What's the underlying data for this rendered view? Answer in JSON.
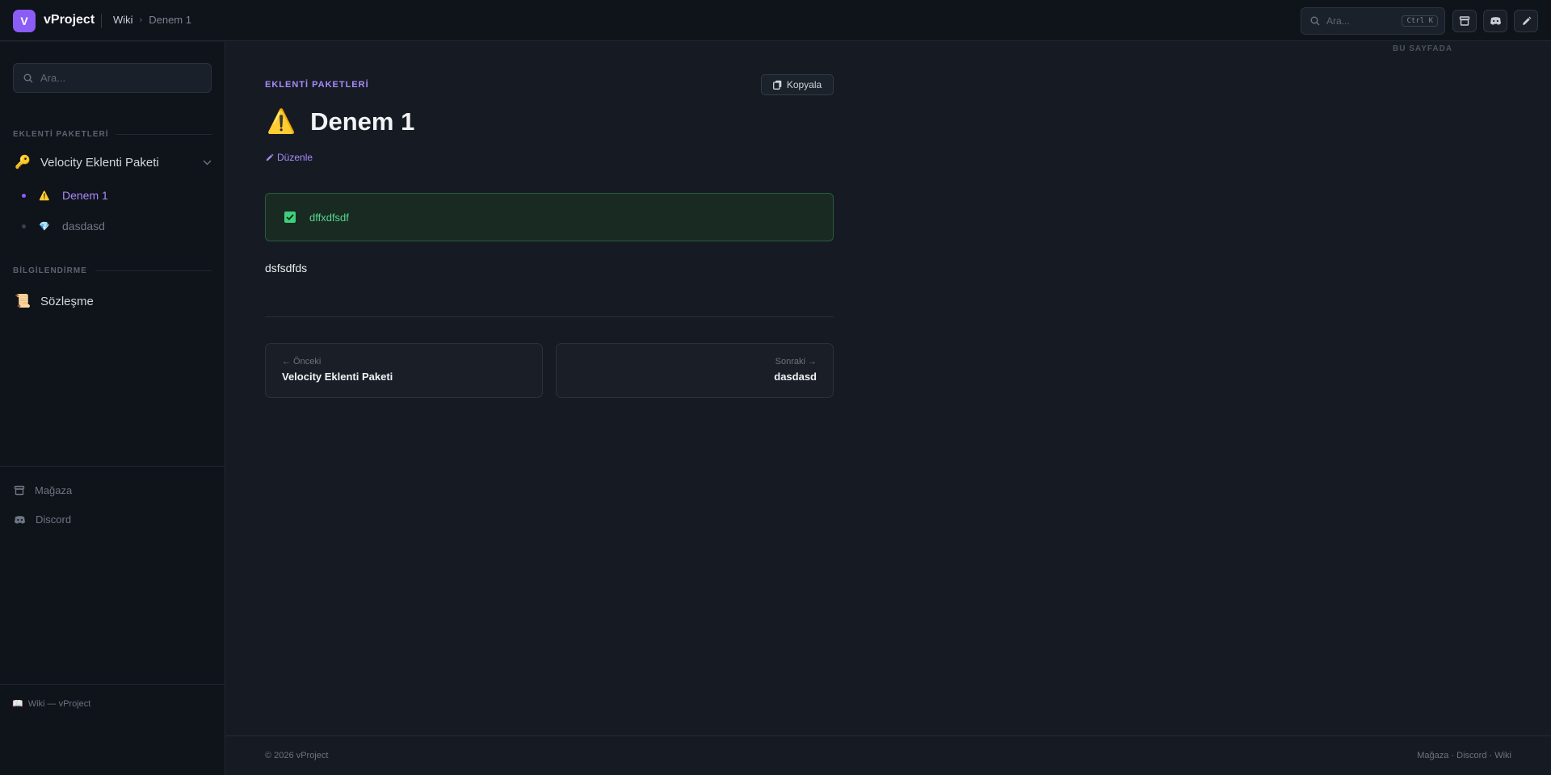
{
  "topbar": {
    "logo_letter": "V",
    "app_name": "vProject",
    "breadcrumb": {
      "home": "Wiki",
      "separator": "›",
      "current": "Denem 1"
    },
    "search": {
      "placeholder": "Ara...",
      "shortcut": "Ctrl K"
    },
    "icons": [
      "store-icon",
      "discord-icon",
      "pencil-icon"
    ]
  },
  "sidebar": {
    "search_placeholder": "Ara...",
    "sections": [
      {
        "heading": "EKLENTİ PAKETLERİ",
        "group": {
          "emoji": "🔑",
          "label": "Velocity Eklenti Paketi",
          "expanded": true
        },
        "children": [
          {
            "emoji": "⚠️",
            "label": "Denem 1",
            "active": true
          },
          {
            "emoji": "💎",
            "label": "dasdasd",
            "active": false
          }
        ]
      },
      {
        "heading": "BİLGİLENDİRME",
        "items": [
          {
            "emoji": "📜",
            "label": "Sözleşme"
          }
        ]
      }
    ],
    "links": [
      {
        "icon": "store-icon",
        "label": "Mağaza"
      },
      {
        "icon": "discord-icon",
        "label": "Discord"
      }
    ],
    "footer": {
      "emoji": "📖",
      "text": "Wiki — vProject"
    }
  },
  "main": {
    "category": "EKLENTİ PAKETLERİ",
    "copy_label": "Kopyala",
    "title_emoji": "⚠️",
    "title": "Denem 1",
    "edit_label": "Düzenle",
    "callout": {
      "text": "dffxdfsdf"
    },
    "body": "dsfsdfds",
    "prev": {
      "hint": "← Önceki",
      "title": "Velocity Eklenti Paketi"
    },
    "next": {
      "hint": "Sonraki →",
      "title": "dasdasd"
    },
    "toc_label": "BU SAYFADA"
  },
  "footer": {
    "copyright": "© 2026 vProject",
    "links": "Mağaza · Discord · Wiki"
  },
  "colors": {
    "accent": "#8b5cf6",
    "accent_text": "#a78bfa",
    "success": "#3ecf7a",
    "background": "#161b23",
    "sidebar_bg": "#0f131a"
  }
}
